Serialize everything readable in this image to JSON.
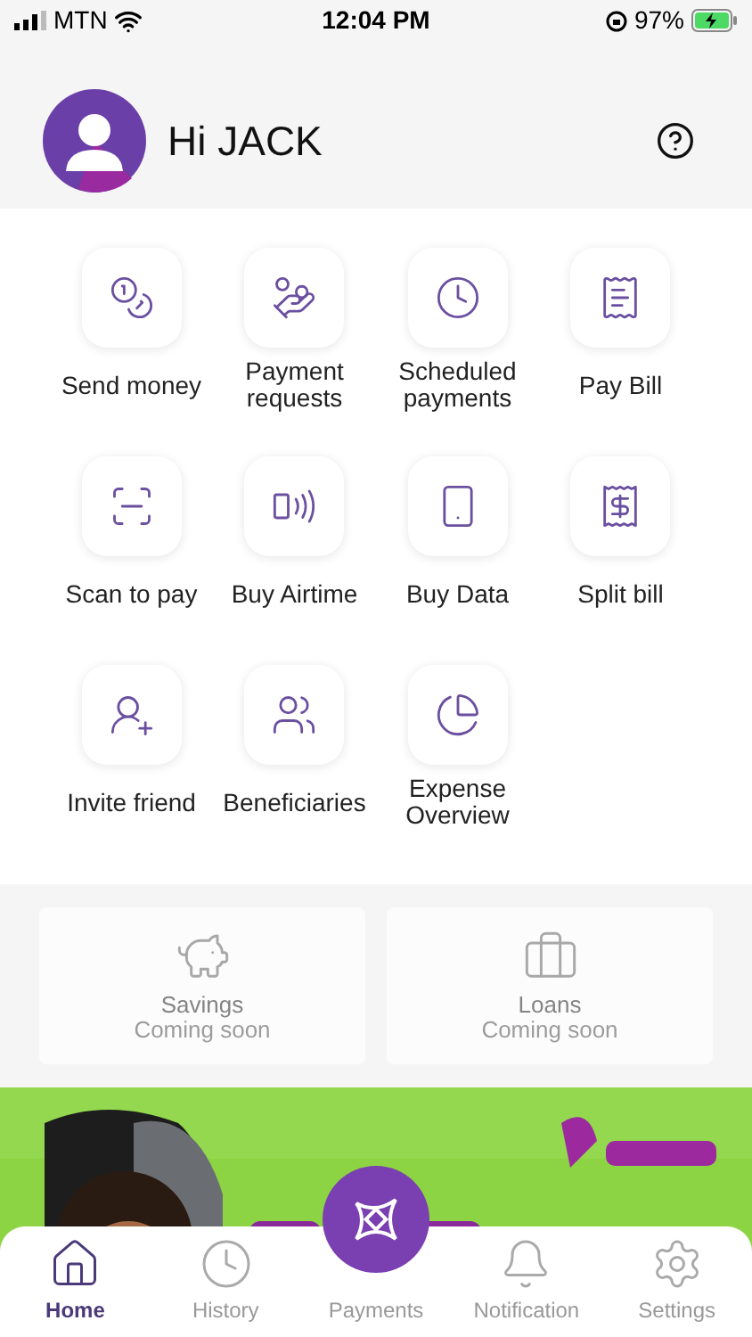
{
  "status_bar": {
    "carrier": "MTN",
    "time": "12:04 PM",
    "battery": "97%"
  },
  "header": {
    "greeting": "Hi JACK"
  },
  "services": [
    {
      "label": "Send money"
    },
    {
      "label": "Payment requests"
    },
    {
      "label": "Scheduled payments"
    },
    {
      "label": "Pay Bill"
    },
    {
      "label": "Scan to pay"
    },
    {
      "label": "Buy Airtime"
    },
    {
      "label": "Buy Data"
    },
    {
      "label": "Split bill"
    },
    {
      "label": "Invite friend"
    },
    {
      "label": "Beneficiaries"
    },
    {
      "label": "Expense Overview"
    }
  ],
  "products": [
    {
      "title": "Savings",
      "note": "Coming soon",
      "disabled": true
    },
    {
      "title": "Loans",
      "note": "Coming soon",
      "disabled": true
    }
  ],
  "bottom_nav": [
    {
      "label": "Home",
      "selected": true
    },
    {
      "label": "History",
      "selected": false
    },
    {
      "label": "Payments",
      "selected": false,
      "kind": "center"
    },
    {
      "label": "Notification",
      "selected": false
    },
    {
      "label": "Settings",
      "selected": false
    }
  ]
}
